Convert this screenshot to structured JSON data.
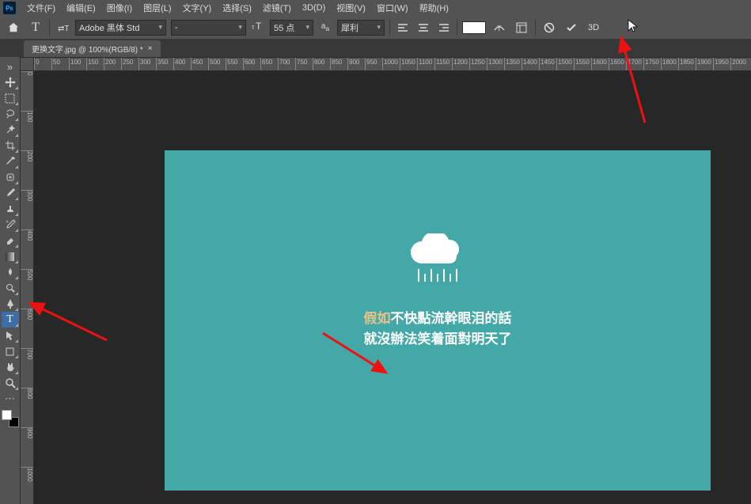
{
  "app_logo": "Ps",
  "menu": {
    "file": "文件(F)",
    "edit": "编辑(E)",
    "image": "图像(I)",
    "layer": "图层(L)",
    "type": "文字(Y)",
    "select": "选择(S)",
    "filter": "滤镜(T)",
    "threeD": "3D(D)",
    "view": "视图(V)",
    "window": "窗口(W)",
    "help": "帮助(H)"
  },
  "options": {
    "font_family": "Adobe 黑体 Std",
    "font_style": "-",
    "font_size": "55 点",
    "aa_mode": "犀利",
    "text_color": "#ffffff",
    "threeD_label": "3D"
  },
  "tab": {
    "title": "更换文字.jpg @ 100%(RGB/8) *"
  },
  "ruler_h": [
    "0",
    "50",
    "100",
    "150",
    "200",
    "250",
    "300",
    "350",
    "400",
    "450",
    "500",
    "550",
    "600",
    "650",
    "700",
    "750",
    "800",
    "850",
    "900",
    "950",
    "1000",
    "1050",
    "1100",
    "1150",
    "1200",
    "1250",
    "1300",
    "1350",
    "1400",
    "1450",
    "1500",
    "1550",
    "1600",
    "1650",
    "1700",
    "1750",
    "1800",
    "1850",
    "1900",
    "1950",
    "2000"
  ],
  "ruler_v": [
    "0",
    "100",
    "200",
    "300",
    "400",
    "500",
    "600",
    "700",
    "800",
    "900",
    "1000"
  ],
  "canvas": {
    "bg_color": "#45a8a8",
    "text_line1_a": "假如",
    "text_line1_b": "不快點流幹眼泪的話",
    "text_line2": "就沒辦法笑着面對明天了"
  }
}
